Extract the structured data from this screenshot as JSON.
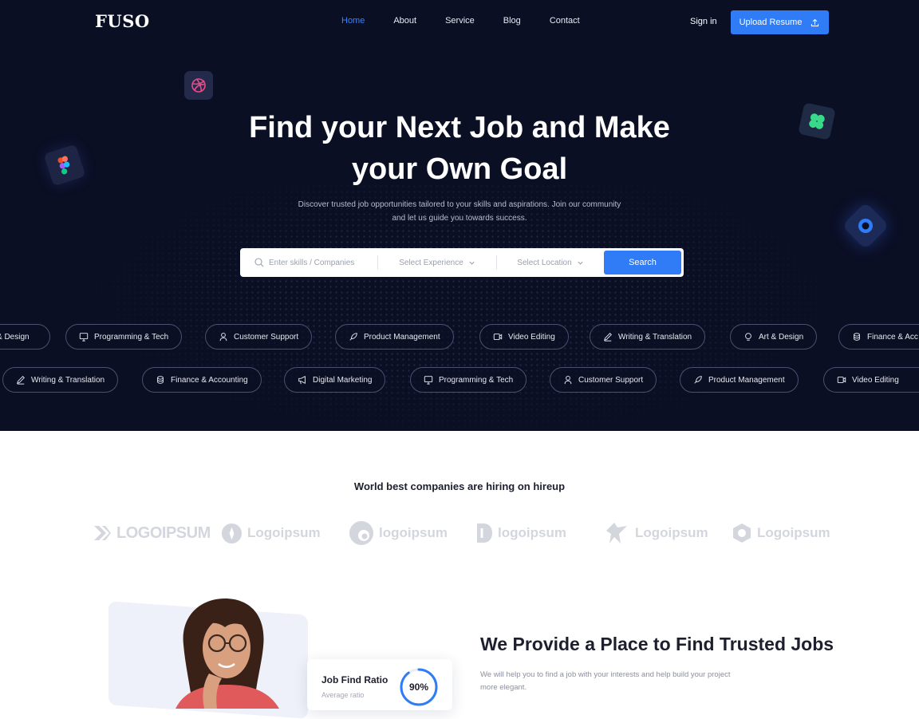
{
  "nav": {
    "logo": "FUSO",
    "links": [
      {
        "label": "Home",
        "active": true
      },
      {
        "label": "About",
        "active": false
      },
      {
        "label": "Service",
        "active": false
      },
      {
        "label": "Blog",
        "active": false
      },
      {
        "label": "Contact",
        "active": false
      }
    ],
    "sign_in": "Sign in",
    "upload_resume": "Upload Resume"
  },
  "hero": {
    "headline_line1": "Find your Next Job and Make",
    "headline_line2": "your Own Goal",
    "subtext_line1": "Discover trusted job opportunities tailored to your skills and aspirations. Join our community",
    "subtext_line2": "and let us guide you towards success.",
    "floating_icons": [
      "dribbble-icon",
      "figma-icon",
      "clover-icon",
      "shield-icon"
    ]
  },
  "search": {
    "skills_placeholder": "Enter skills / Companies",
    "experience_label": "Select Experience",
    "location_label": "Select Location",
    "button_label": "Search"
  },
  "categories_row1": [
    {
      "label": "Art & Design",
      "icon": "lightbulb-icon",
      "visible_text": "& Design"
    },
    {
      "label": "Programming & Tech",
      "icon": "monitor-icon"
    },
    {
      "label": "Customer Support",
      "icon": "user-icon"
    },
    {
      "label": "Product Management",
      "icon": "rocket-icon"
    },
    {
      "label": "Video Editing",
      "icon": "video-icon"
    },
    {
      "label": "Writing & Translation",
      "icon": "pen-icon"
    },
    {
      "label": "Art & Design",
      "icon": "lightbulb-icon"
    },
    {
      "label": "Finance & Accounting",
      "icon": "coins-icon",
      "visible_text": "Finance & Acc"
    }
  ],
  "categories_row2": [
    {
      "label": "Writing & Translation",
      "icon": "pen-icon"
    },
    {
      "label": "Finance & Accounting",
      "icon": "coins-icon"
    },
    {
      "label": "Digital Marketing",
      "icon": "megaphone-icon"
    },
    {
      "label": "Programming & Tech",
      "icon": "monitor-icon"
    },
    {
      "label": "Customer Support",
      "icon": "user-icon"
    },
    {
      "label": "Product Management",
      "icon": "rocket-icon"
    },
    {
      "label": "Video Editing",
      "icon": "video-icon"
    }
  ],
  "companies": {
    "title": "World best companies are hiring on hireup",
    "logos": [
      "LOGOIPSUM",
      "Logoipsum",
      "logoipsum",
      "logoipsum",
      "Logoipsum",
      "Logoipsum"
    ]
  },
  "feature": {
    "ratio_title": "Job Find Ratio",
    "ratio_subtitle": "Average ratio",
    "ratio_value": "90%",
    "ratio_fraction": 0.9,
    "title": "We Provide a Place to Find Trusted Jobs",
    "text_line1": "We will help you to find a job with your interests and help build your project",
    "text_line2": "more elegant."
  },
  "colors": {
    "hero_bg": "#0b0f24",
    "accent": "#2f7cf6",
    "logo_gray": "#d4d6de"
  }
}
